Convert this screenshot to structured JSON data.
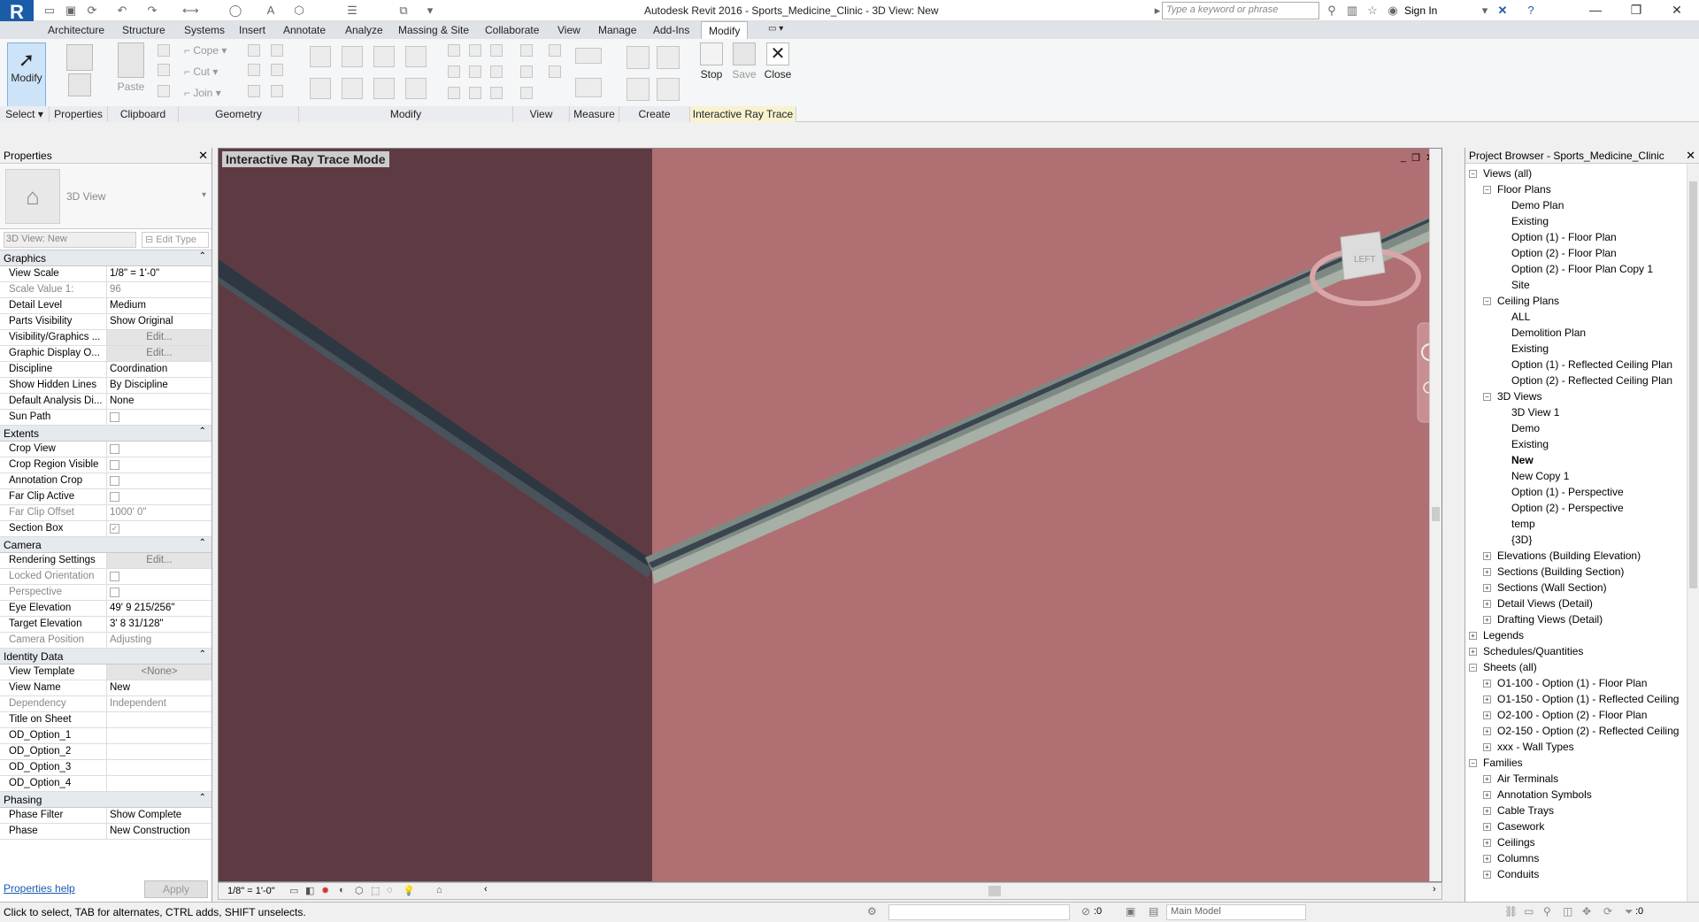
{
  "window": {
    "title": "Autodesk Revit 2016 -     Sports_Medicine_Clinic - 3D View: New"
  },
  "search": {
    "placeholder": "Type a keyword or phrase"
  },
  "user": {
    "sign_in": "Sign In"
  },
  "tabs": [
    "Architecture",
    "Structure",
    "Systems",
    "Insert",
    "Annotate",
    "Analyze",
    "Massing & Site",
    "Collaborate",
    "View",
    "Manage",
    "Add-Ins",
    "Modify"
  ],
  "ribbon": {
    "modify_btn": "Modify",
    "paste": "Paste",
    "cope": "Cope",
    "cut": "Cut",
    "join": "Join",
    "stop": "Stop",
    "save": "Save",
    "close": "Close",
    "panels": [
      "Select",
      "Properties",
      "Clipboard",
      "Geometry",
      "Modify",
      "View",
      "Measure",
      "Create",
      "Interactive Ray Trace"
    ]
  },
  "properties": {
    "title": "Properties",
    "type_name": "3D View",
    "instance": "3D View: New",
    "edit_type": "Edit Type",
    "help": "Properties help",
    "apply": "Apply",
    "sections": {
      "graphics": "Graphics",
      "extents": "Extents",
      "camera": "Camera",
      "identity": "Identity Data",
      "phasing": "Phasing"
    },
    "graphics": [
      {
        "k": "View Scale",
        "v": "1/8\" = 1'-0\""
      },
      {
        "k": "Scale Value    1:",
        "v": "96"
      },
      {
        "k": "Detail Level",
        "v": "Medium"
      },
      {
        "k": "Parts Visibility",
        "v": "Show Original"
      },
      {
        "k": "Visibility/Graphics ...",
        "v": "Edit..."
      },
      {
        "k": "Graphic Display O...",
        "v": "Edit..."
      },
      {
        "k": "Discipline",
        "v": "Coordination"
      },
      {
        "k": "Show Hidden Lines",
        "v": "By Discipline"
      },
      {
        "k": "Default Analysis Di...",
        "v": "None"
      },
      {
        "k": "Sun Path",
        "v": ""
      }
    ],
    "extents": [
      {
        "k": "Crop View",
        "v": ""
      },
      {
        "k": "Crop Region Visible",
        "v": ""
      },
      {
        "k": "Annotation Crop",
        "v": ""
      },
      {
        "k": "Far Clip Active",
        "v": ""
      },
      {
        "k": "Far Clip Offset",
        "v": "1000'  0\""
      },
      {
        "k": "Section Box",
        "v": "✓"
      }
    ],
    "camera": [
      {
        "k": "Rendering Settings",
        "v": "Edit..."
      },
      {
        "k": "Locked Orientation",
        "v": ""
      },
      {
        "k": "Perspective",
        "v": ""
      },
      {
        "k": "Eye Elevation",
        "v": "49'  9 215/256\""
      },
      {
        "k": "Target Elevation",
        "v": "3'  8 31/128\""
      },
      {
        "k": "Camera Position",
        "v": "Adjusting"
      }
    ],
    "identity": [
      {
        "k": "View Template",
        "v": "<None>"
      },
      {
        "k": "View Name",
        "v": "New"
      },
      {
        "k": "Dependency",
        "v": "Independent"
      },
      {
        "k": "Title on Sheet",
        "v": ""
      },
      {
        "k": "OD_Option_1",
        "v": ""
      },
      {
        "k": "OD_Option_2",
        "v": ""
      },
      {
        "k": "OD_Option_3",
        "v": ""
      },
      {
        "k": "OD_Option_4",
        "v": ""
      }
    ],
    "phasing": [
      {
        "k": "Phase Filter",
        "v": "Show Complete"
      },
      {
        "k": "Phase",
        "v": "New Construction"
      }
    ]
  },
  "view": {
    "label": "Interactive Ray Trace Mode",
    "scale": "1/8\" = 1'-0\"",
    "viewcube_face": "LEFT"
  },
  "browser": {
    "title": "Project Browser - Sports_Medicine_Clinic",
    "items": [
      {
        "t": "Views (all)",
        "lvl": 0
      },
      {
        "t": "Floor Plans",
        "lvl": 1
      },
      {
        "t": "Demo Plan",
        "lvl": 2
      },
      {
        "t": "Existing",
        "lvl": 2
      },
      {
        "t": "Option (1) - Floor Plan",
        "lvl": 2
      },
      {
        "t": "Option (2) - Floor Plan",
        "lvl": 2
      },
      {
        "t": "Option (2) - Floor Plan Copy 1",
        "lvl": 2
      },
      {
        "t": "Site",
        "lvl": 2
      },
      {
        "t": "Ceiling Plans",
        "lvl": 1
      },
      {
        "t": "ALL",
        "lvl": 2
      },
      {
        "t": "Demolition Plan",
        "lvl": 2
      },
      {
        "t": "Existing",
        "lvl": 2
      },
      {
        "t": "Option (1) - Reflected Ceiling Plan",
        "lvl": 2
      },
      {
        "t": "Option (2) - Reflected Ceiling Plan",
        "lvl": 2
      },
      {
        "t": "3D Views",
        "lvl": 1
      },
      {
        "t": "3D View 1",
        "lvl": 2
      },
      {
        "t": "Demo",
        "lvl": 2
      },
      {
        "t": "Existing",
        "lvl": 2
      },
      {
        "t": "New",
        "lvl": 2,
        "bold": true
      },
      {
        "t": "New Copy 1",
        "lvl": 2
      },
      {
        "t": "Option (1) - Perspective",
        "lvl": 2
      },
      {
        "t": "Option (2) - Perspective",
        "lvl": 2
      },
      {
        "t": "temp",
        "lvl": 2
      },
      {
        "t": "{3D}",
        "lvl": 2
      },
      {
        "t": "Elevations (Building Elevation)",
        "lvl": 1
      },
      {
        "t": "Sections (Building Section)",
        "lvl": 1
      },
      {
        "t": "Sections (Wall Section)",
        "lvl": 1
      },
      {
        "t": "Detail Views (Detail)",
        "lvl": 1
      },
      {
        "t": "Drafting Views (Detail)",
        "lvl": 1
      },
      {
        "t": "Legends",
        "lvl": 0
      },
      {
        "t": "Schedules/Quantities",
        "lvl": 0
      },
      {
        "t": "Sheets (all)",
        "lvl": 0
      },
      {
        "t": "O1-100 - Option (1) - Floor Plan",
        "lvl": 1
      },
      {
        "t": "O1-150 - Option (1) - Reflected Ceiling",
        "lvl": 1
      },
      {
        "t": "O2-100 - Option (2) - Floor Plan",
        "lvl": 1
      },
      {
        "t": "O2-150 - Option (2) - Reflected Ceiling",
        "lvl": 1
      },
      {
        "t": "xxx - Wall Types",
        "lvl": 1
      },
      {
        "t": "Families",
        "lvl": 0
      },
      {
        "t": "Air Terminals",
        "lvl": 1
      },
      {
        "t": "Annotation Symbols",
        "lvl": 1
      },
      {
        "t": "Cable Trays",
        "lvl": 1
      },
      {
        "t": "Casework",
        "lvl": 1
      },
      {
        "t": "Ceilings",
        "lvl": 1
      },
      {
        "t": "Columns",
        "lvl": 1
      },
      {
        "t": "Conduits",
        "lvl": 1
      }
    ]
  },
  "status": {
    "text": "Click to select, TAB for alternates, CTRL adds, SHIFT unselects.",
    "main_model": "Main Model",
    "count_a": ":0",
    "count_b": ":0"
  }
}
